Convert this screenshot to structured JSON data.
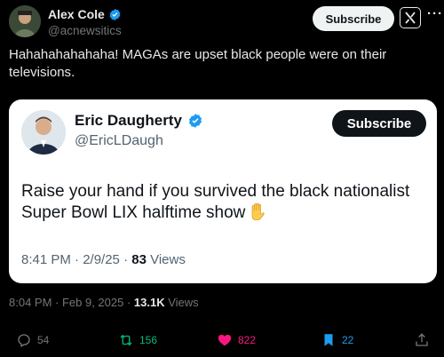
{
  "tweet": {
    "author_name": "Alex Cole",
    "author_handle": "@acnewsitics",
    "subscribe_label": "Subscribe",
    "more_label": "···",
    "text": "Hahahahahahaha! MAGAs are upset black people were on their televisions.",
    "time": "8:04 PM · Feb 9, 2025 · ",
    "views_count": "13.1K",
    "views_label": " Views"
  },
  "quote": {
    "author_name": "Eric Daugherty",
    "author_handle": "@EricLDaugh",
    "subscribe_label": "Subscribe",
    "text": "Raise your hand if you survived the black nationalist Super Bowl LIX halftime show",
    "time": "8:41 PM · 2/9/25 · ",
    "views_count": "83",
    "views_label": " Views"
  },
  "actions": {
    "replies": "54",
    "reposts": "156",
    "likes": "822",
    "bookmarks": "22"
  },
  "colors": {
    "background": "#000000",
    "verified": "#1d9bf0",
    "repost": "#00ba7c",
    "like": "#f91880",
    "bookmark": "#1d9bf0"
  },
  "icons": [
    "verified-badge-icon",
    "grok-icon",
    "more-icon",
    "raised-hand-emoji",
    "reply-icon",
    "repost-icon",
    "like-icon",
    "bookmark-icon",
    "share-icon"
  ]
}
